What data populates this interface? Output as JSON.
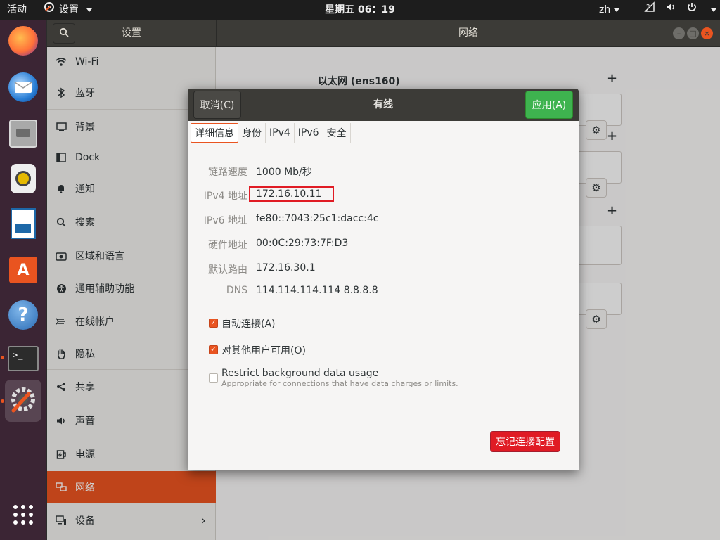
{
  "topbar": {
    "activities": "活动",
    "app_name": "设置",
    "clock": "星期五 06：19",
    "lang": "zh"
  },
  "settings": {
    "sidebar_title": "设置",
    "main_title": "网络",
    "sidebar": {
      "items": [
        {
          "label": "Wi-Fi",
          "icon": "wifi-icon"
        },
        {
          "label": "蓝牙",
          "icon": "bluetooth-icon"
        },
        {
          "label": "背景",
          "icon": "background-icon"
        },
        {
          "label": "Dock",
          "icon": "dock-icon"
        },
        {
          "label": "通知",
          "icon": "bell-icon"
        },
        {
          "label": "搜索",
          "icon": "search-icon"
        },
        {
          "label": "区域和语言",
          "icon": "camera-icon"
        },
        {
          "label": "通用辅助功能",
          "icon": "accessibility-icon"
        },
        {
          "label": "在线帐户",
          "icon": "online-accounts-icon"
        },
        {
          "label": "隐私",
          "icon": "hand-icon"
        },
        {
          "label": "共享",
          "icon": "share-icon"
        },
        {
          "label": "声音",
          "icon": "speaker-icon"
        },
        {
          "label": "电源",
          "icon": "power-icon"
        },
        {
          "label": "网络",
          "icon": "network-icon",
          "selected": true
        },
        {
          "label": "设备",
          "icon": "devices-icon"
        }
      ]
    },
    "main": {
      "ethernet_title": "以太网 (ens160)"
    }
  },
  "dialog": {
    "cancel_label": "取消(C)",
    "title": "有线",
    "apply_label": "应用(A)",
    "tabs": [
      "详细信息",
      "身份",
      "IPv4",
      "IPv6",
      "安全"
    ],
    "details": [
      {
        "label": "链路速度",
        "value": "1000 Mb/秒"
      },
      {
        "label": "IPv4 地址",
        "value": "172.16.10.11"
      },
      {
        "label": "IPv6 地址",
        "value": "fe80::7043:25c1:dacc:4c"
      },
      {
        "label": "硬件地址",
        "value": "00:0C:29:73:7F:D3"
      },
      {
        "label": "默认路由",
        "value": "172.16.30.1"
      },
      {
        "label": "DNS",
        "value": "114.114.114.114 8.8.8.8"
      }
    ],
    "auto_connect": {
      "label": "自动连接(A)",
      "checked": true
    },
    "all_users": {
      "label": "对其他用户可用(O)",
      "checked": true
    },
    "restrict": {
      "label": "Restrict background data usage",
      "sublabel": "Appropriate for connections that have data charges or limits.",
      "checked": false
    },
    "forget_label": "忘记连接配置"
  },
  "colors": {
    "accent": "#e95420",
    "apply": "#3eb34f",
    "danger": "#e01b24",
    "headerbar": "#3c3b37"
  }
}
